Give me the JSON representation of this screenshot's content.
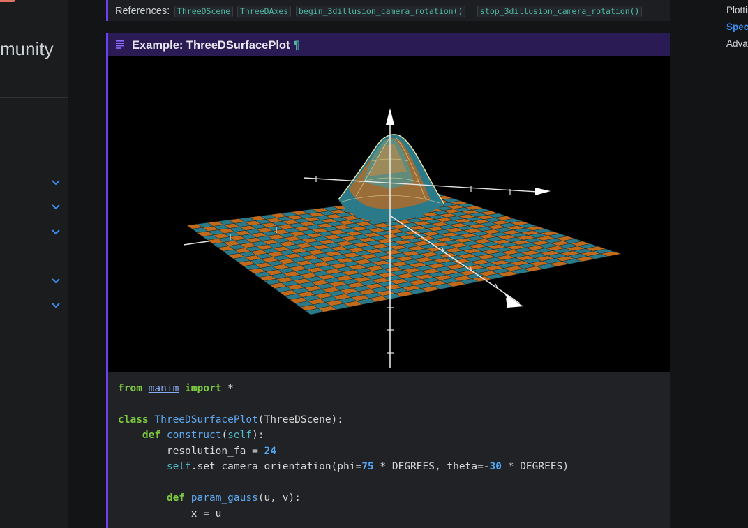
{
  "sidebar": {
    "brand_fragment": "munity",
    "accent_color": "#e07264",
    "expand_icons": [
      "chevron-down-icon",
      "chevron-down-icon",
      "chevron-down-icon",
      "chevron-down-icon",
      "chevron-down-icon"
    ]
  },
  "references": {
    "label": "References:",
    "items": [
      "ThreeDScene",
      "ThreeDAxes",
      "begin_3dillusion_camera_rotation()",
      "stop_3dillusion_camera_rotation()"
    ]
  },
  "example": {
    "title": "Example: ThreeDSurfacePlot",
    "anchor": "¶",
    "accent_color": "#6f3ff5",
    "header_color": "#2a1b55",
    "surface_colors": [
      "#c26a1c",
      "#2a7a8a"
    ]
  },
  "code": {
    "l1": {
      "a": "from",
      "b": "manim",
      "c": "import",
      "d": "*"
    },
    "l2": {
      "a": "class",
      "b": "ThreeDSurfacePlot",
      "c": "(ThreeDScene):"
    },
    "l3": {
      "a": "def",
      "b": "construct",
      "c": "(",
      "d": "self",
      "e": "):"
    },
    "l4": {
      "a": "resolution_fa",
      "b": " = ",
      "c": "24"
    },
    "l5": {
      "a": "self",
      "b": ".set_camera_orientation(phi=",
      "c": "75",
      "d": " * DEGREES, theta=-",
      "e": "30",
      "f": " * DEGREES)"
    },
    "l6": {
      "a": "def",
      "b": "param_gauss",
      "c": "(u, v):"
    },
    "l7": {
      "a": "x = u"
    }
  },
  "toc": {
    "items": [
      {
        "label": "Plotting",
        "active": false
      },
      {
        "label": "Special",
        "active": true
      },
      {
        "label": "Advanced",
        "active": false
      }
    ],
    "active_color": "#3b8ef0"
  }
}
